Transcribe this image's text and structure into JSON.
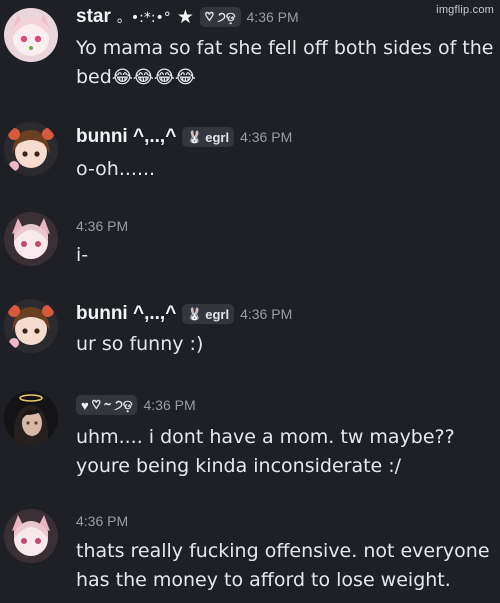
{
  "watermark": "imgflip.com",
  "messages": [
    {
      "author": "star",
      "decoration": "。•:*:•°",
      "tag": "♡ ੭ଡ଼",
      "time": "4:36 PM",
      "text": "Yo mama so fat she fell off both sides of the bed",
      "emojis": "😂😂😂😂"
    },
    {
      "author": "bunni ^,..,^",
      "tag": "egrl",
      "time": "4:36 PM",
      "text": "o-oh......"
    },
    {
      "time": "4:36 PM",
      "text": "i-"
    },
    {
      "author": "bunni ^,..,^",
      "tag": "egrl",
      "time": "4:36 PM",
      "text": "ur so funny :)"
    },
    {
      "tag": "♡ ⁓ ੭ଡ଼",
      "time": "4:36 PM",
      "text": "uhm.... i dont have a mom. tw maybe?? youre being kinda inconsiderate :/"
    },
    {
      "time": "4:36 PM",
      "text": "thats really fucking offensive. not everyone has the money to afford to lose weight."
    }
  ],
  "colors": {
    "background": "#1f2026",
    "text": "#e6e7ea",
    "timestamp": "#9a9ca5",
    "tag_bg": "#34363e"
  },
  "icons": [
    "avatar-pink-cat-girl",
    "avatar-brown-hair-girl",
    "avatar-dark-hair-halo",
    "bunny-icon",
    "heart-icon",
    "star-icon"
  ]
}
